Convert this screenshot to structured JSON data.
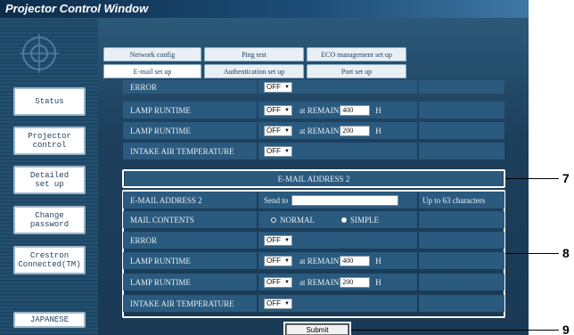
{
  "window": {
    "title": "Projector Control Window"
  },
  "sidebar": {
    "buttons": [
      "Status",
      "Projector\ncontrol",
      "Detailed\nset up",
      "Change\npassword",
      "Crestron\nConnected(TM)",
      "JAPANESE"
    ]
  },
  "tabs": {
    "row1": [
      "Network config",
      "Ping test",
      "ECO management set up"
    ],
    "row2": [
      "E-mail set up",
      "Authentication set up",
      "Port set up"
    ]
  },
  "upper": {
    "error_label": "ERROR",
    "error_value": "OFF",
    "lamp1_label": "LAMP  RUNTIME",
    "lamp1_value": "OFF",
    "lamp1_remain_label": "at REMAIN",
    "lamp1_remain": "400",
    "lamp1_unit": "H",
    "lamp2_label": "LAMP  RUNTIME",
    "lamp2_value": "OFF",
    "lamp2_remain_label": "at REMAIN",
    "lamp2_remain": "200",
    "lamp2_unit": "H",
    "intake_label": "INTAKE AIR TEMPERATURE",
    "intake_value": "OFF"
  },
  "email2": {
    "section_header": "E-MAIL ADDRESS 2",
    "address_label": "E-MAIL ADDRESS 2",
    "send_to_label": "Send to",
    "address_value": "",
    "hint": "Up to 63 characters",
    "contents_label": "MAIL CONTENTS",
    "contents_options": [
      "NORMAL",
      "SIMPLE"
    ],
    "contents_selected": "SIMPLE",
    "error_label": "ERROR",
    "error_value": "OFF",
    "lamp1_label": "LAMP  RUNTIME",
    "lamp1_value": "OFF",
    "lamp1_remain_label": "at REMAIN",
    "lamp1_remain": "400",
    "lamp1_unit": "H",
    "lamp2_label": "LAMP  RUNTIME",
    "lamp2_value": "OFF",
    "lamp2_remain_label": "at REMAIN",
    "lamp2_remain": "200",
    "lamp2_unit": "H",
    "intake_label": "INTAKE AIR TEMPERATURE",
    "intake_value": "OFF"
  },
  "submit_label": "Submit",
  "callouts": [
    "7",
    "8",
    "9"
  ]
}
